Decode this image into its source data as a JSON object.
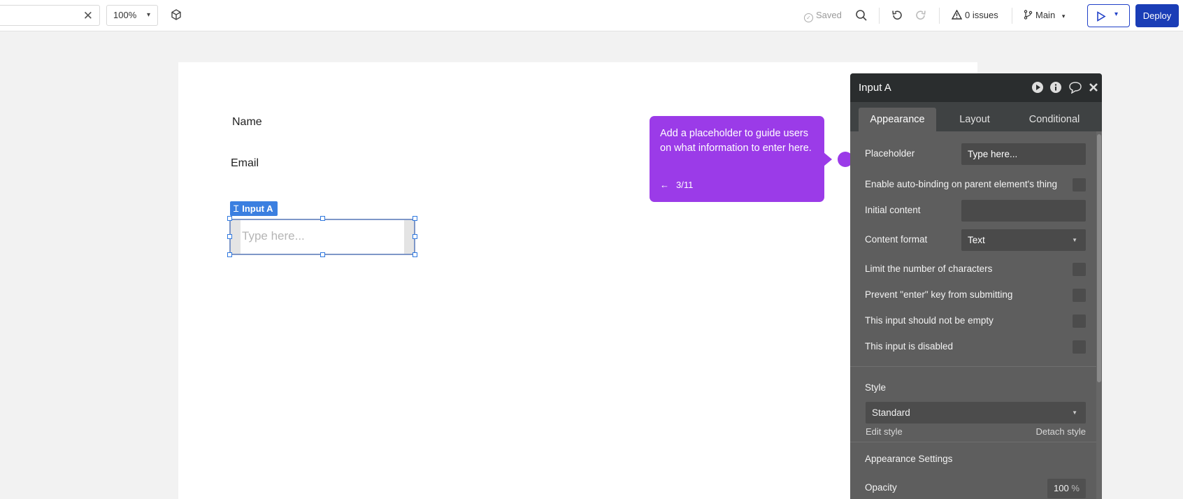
{
  "toolbar": {
    "zoom": "100%",
    "saved": "Saved",
    "issues": "0 issues",
    "branch": "Main",
    "deploy": "Deploy"
  },
  "canvas": {
    "name_label": "Name",
    "email_label": "Email",
    "element_tag": "Input A",
    "input_placeholder": "Type here..."
  },
  "tooltip": {
    "text": "Add a placeholder to guide users on what information to enter here.",
    "step": "3/11"
  },
  "panel": {
    "title": "Input A",
    "tabs": [
      "Appearance",
      "Layout",
      "Conditional"
    ],
    "placeholder_label": "Placeholder",
    "placeholder_value": "Type here...",
    "auto_binding": "Enable auto-binding on parent element's thing",
    "initial_content": "Initial content",
    "content_format_label": "Content format",
    "content_format_value": "Text",
    "limit_chars": "Limit the number of characters",
    "prevent_enter": "Prevent \"enter\" key from submitting",
    "not_empty": "This input should not be empty",
    "disabled": "This input is disabled",
    "style_label": "Style",
    "style_value": "Standard",
    "edit_style": "Edit style",
    "detach_style": "Detach style",
    "appearance_settings": "Appearance Settings",
    "opacity_label": "Opacity",
    "opacity_value": "100",
    "opacity_unit": "%"
  },
  "colors": {
    "accent": "#1a3db6",
    "tooltip": "#9b3be8",
    "panel_bg": "#5e5e5e",
    "selection": "#2e78e0"
  }
}
